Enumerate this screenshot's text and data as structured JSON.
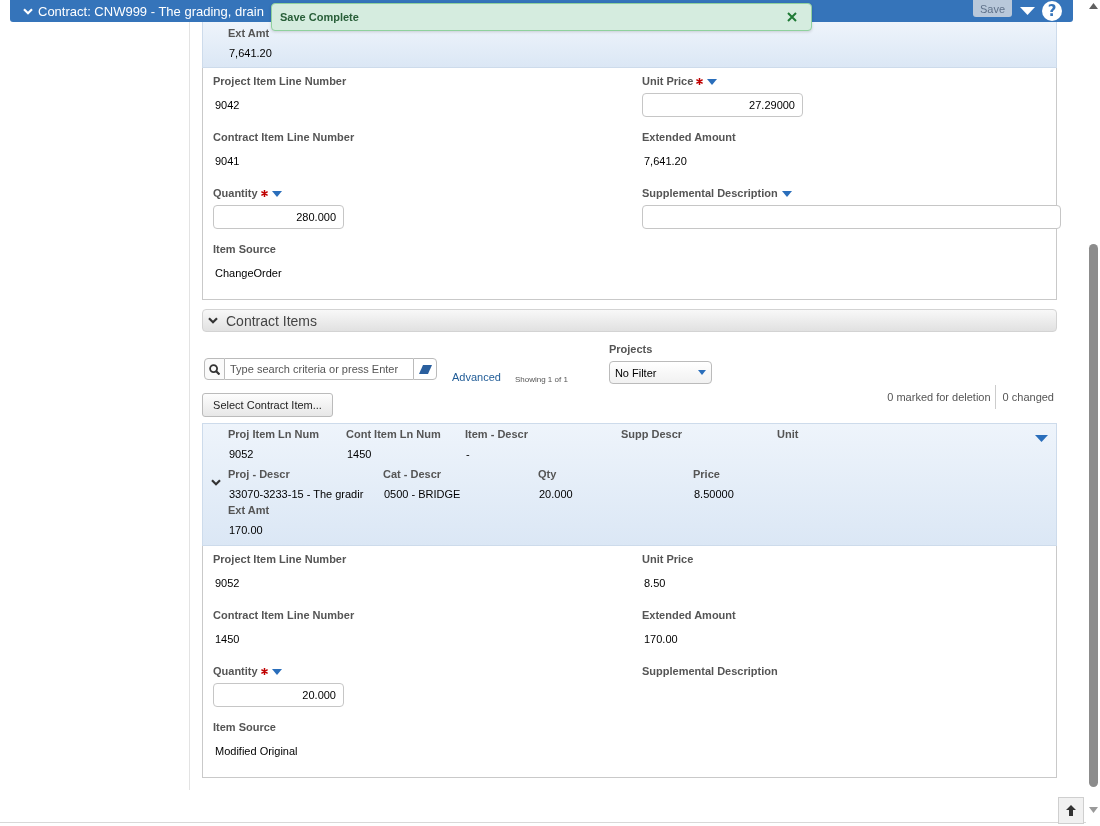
{
  "header": {
    "title": "Contract: CNW999 - The grading, drain",
    "save": {
      "label": "Save",
      "disabled": true
    },
    "help": "?"
  },
  "toast": {
    "message": "Save Complete"
  },
  "upper_item": {
    "summary_rows": [
      [
        {
          "label": "Ext Amt",
          "value": "7,641.20"
        }
      ]
    ],
    "fields": [
      {
        "kind": "text",
        "label": "Project Item Line Number",
        "required": false,
        "menu": false,
        "value": "9042"
      },
      {
        "kind": "number",
        "label": "Unit Price",
        "required": true,
        "menu": true,
        "value": "27.29000"
      },
      {
        "kind": "text",
        "label": "Contract Item Line Number",
        "required": false,
        "menu": false,
        "value": "9041"
      },
      {
        "kind": "text",
        "label": "Extended Amount",
        "required": false,
        "menu": false,
        "value": "7,641.20"
      },
      {
        "kind": "number",
        "label": "Quantity",
        "required": true,
        "menu": true,
        "value": "280.000"
      },
      {
        "kind": "textbox",
        "label": "Supplemental Description",
        "required": false,
        "menu": true
      },
      {
        "kind": "text",
        "label": "Item Source",
        "required": false,
        "menu": false,
        "value": "ChangeOrder"
      }
    ]
  },
  "contract_items": {
    "title": "Contract Items",
    "expanded": true,
    "search": {
      "placeholder": "Type search criteria or press Enter"
    },
    "advanced": "Advanced",
    "showing": "Showing 1 of 1",
    "projects": {
      "label": "Projects",
      "value": "No Filter"
    },
    "select_button": "Select Contract Item...",
    "marked": "0 marked for deletion",
    "changed": "0 changed",
    "rows": [
      {
        "expanded": true,
        "summary_rows": [
          [
            {
              "label": "Proj Item Ln Num",
              "value": "9052"
            },
            {
              "label": "Cont Item Ln Num",
              "value": "1450"
            },
            {
              "label": "Item - Descr",
              "value": "-"
            },
            {
              "label": "Supp Descr"
            },
            {
              "label": "Unit"
            }
          ],
          [
            {
              "label": "Proj - Descr",
              "value": "33070-3233-15 - The gradir"
            },
            {
              "label": "Cat - Descr",
              "value": "0500 - BRIDGE"
            },
            {
              "label": "Qty",
              "value": "20.000"
            },
            {
              "label": "Price",
              "value": "8.50000"
            }
          ],
          [
            {
              "label": "Ext Amt",
              "value": "170.00"
            }
          ]
        ],
        "fields": [
          {
            "kind": "text",
            "label": "Project Item Line Number",
            "required": false,
            "menu": false,
            "value": "9052"
          },
          {
            "kind": "text",
            "label": "Unit Price",
            "required": false,
            "menu": false,
            "value": "8.50"
          },
          {
            "kind": "text",
            "label": "Contract Item Line Number",
            "required": false,
            "menu": false,
            "value": "1450"
          },
          {
            "kind": "text",
            "label": "Extended Amount",
            "required": false,
            "menu": false,
            "value": "170.00"
          },
          {
            "kind": "number",
            "label": "Quantity",
            "required": true,
            "menu": true,
            "value": "20.000"
          },
          {
            "kind": "text",
            "label": "Supplemental Description",
            "required": false,
            "menu": false
          },
          {
            "kind": "text",
            "label": "Item Source",
            "required": false,
            "menu": false,
            "value": "Modified Original"
          }
        ]
      }
    ]
  }
}
